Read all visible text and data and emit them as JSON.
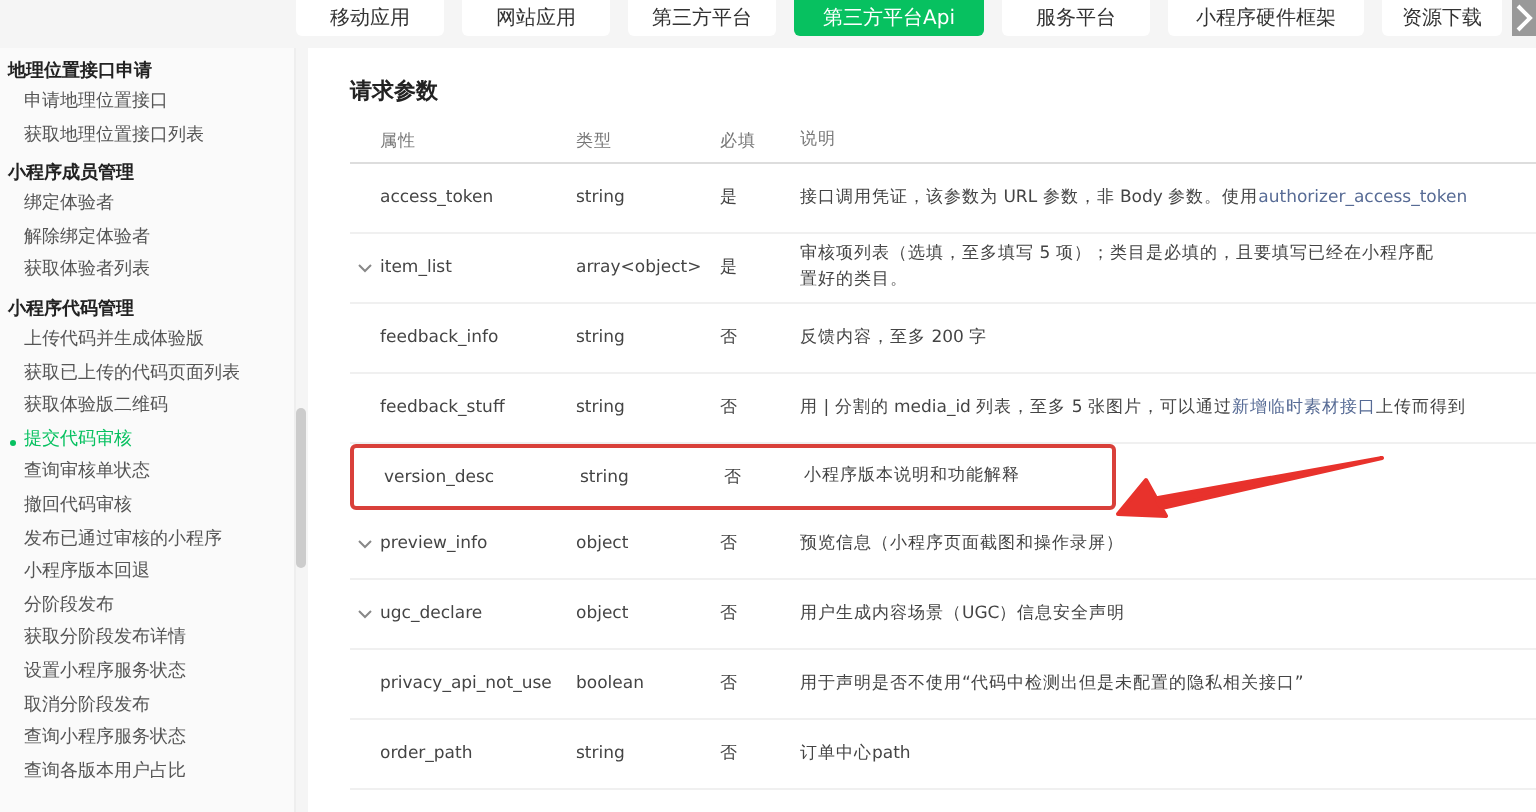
{
  "tabs": [
    {
      "label": "移动应用",
      "selected": false
    },
    {
      "label": "网站应用",
      "selected": false
    },
    {
      "label": "第三方平台",
      "selected": false
    },
    {
      "label": "第三方平台Api",
      "selected": true
    },
    {
      "label": "服务平台",
      "selected": false
    },
    {
      "label": "小程序硬件框架",
      "selected": false
    },
    {
      "label": "资源下载",
      "selected": false
    }
  ],
  "sidebar": {
    "groups": [
      {
        "title": "地理位置接口申请",
        "items": [
          {
            "label": "申请地理位置接口",
            "selected": false
          },
          {
            "label": "获取地理位置接口列表",
            "selected": false
          }
        ]
      },
      {
        "title": "小程序成员管理",
        "items": [
          {
            "label": "绑定体验者",
            "selected": false
          },
          {
            "label": "解除绑定体验者",
            "selected": false
          },
          {
            "label": "获取体验者列表",
            "selected": false
          }
        ]
      },
      {
        "title": "小程序代码管理",
        "items": [
          {
            "label": "上传代码并生成体验版",
            "selected": false
          },
          {
            "label": "获取已上传的代码页面列表",
            "selected": false
          },
          {
            "label": "获取体验版二维码",
            "selected": false
          },
          {
            "label": "提交代码审核",
            "selected": true
          },
          {
            "label": "查询审核单状态",
            "selected": false
          },
          {
            "label": "撤回代码审核",
            "selected": false
          },
          {
            "label": "发布已通过审核的小程序",
            "selected": false
          },
          {
            "label": "小程序版本回退",
            "selected": false
          },
          {
            "label": "分阶段发布",
            "selected": false
          },
          {
            "label": "获取分阶段发布详情",
            "selected": false
          },
          {
            "label": "设置小程序服务状态",
            "selected": false
          },
          {
            "label": "取消分阶段发布",
            "selected": false
          },
          {
            "label": "查询小程序服务状态",
            "selected": false
          },
          {
            "label": "查询各版本用户占比",
            "selected": false
          }
        ]
      }
    ]
  },
  "section_title": "请求参数",
  "table": {
    "columns": [
      "属性",
      "类型",
      "必填",
      "说明"
    ],
    "rows": [
      {
        "name": "access_token",
        "type": "string",
        "required": "是",
        "desc": "接口调用凭证，该参数为 URL 参数，非 Body 参数。使用",
        "link": "authorizer_access_token",
        "expandable": false,
        "highlighted": false
      },
      {
        "name": "item_list",
        "type": "array<object>",
        "required": "是",
        "desc": "审核项列表（选填，至多填写 5 项）；类目是必填的，且要填写已经在小程序配置好的类目。",
        "expandable": true,
        "highlighted": false
      },
      {
        "name": "feedback_info",
        "type": "string",
        "required": "否",
        "desc": "反馈内容，至多 200 字",
        "expandable": false,
        "highlighted": false
      },
      {
        "name": "feedback_stuff",
        "type": "string",
        "required": "否",
        "desc": "用 | 分割的 media_id 列表，至多 5 张图片，可以通过",
        "link": "新增临时素材接口",
        "desc_after": "上传而得到",
        "expandable": false,
        "highlighted": false
      },
      {
        "name": "version_desc",
        "type": "string",
        "required": "否",
        "desc": "小程序版本说明和功能解释",
        "expandable": false,
        "highlighted": true
      },
      {
        "name": "preview_info",
        "type": "object",
        "required": "否",
        "desc": "预览信息（小程序页面截图和操作录屏）",
        "expandable": true,
        "highlighted": false
      },
      {
        "name": "ugc_declare",
        "type": "object",
        "required": "否",
        "desc": "用户生成内容场景（UGC）信息安全声明",
        "expandable": true,
        "highlighted": false
      },
      {
        "name": "privacy_api_not_use",
        "type": "boolean",
        "required": "否",
        "desc": "用于声明是否不使用“代码中检测出但是未配置的隐私相关接口”",
        "expandable": false,
        "highlighted": false
      },
      {
        "name": "order_path",
        "type": "string",
        "required": "否",
        "desc": "订单中心path",
        "expandable": false,
        "highlighted": false
      }
    ]
  }
}
